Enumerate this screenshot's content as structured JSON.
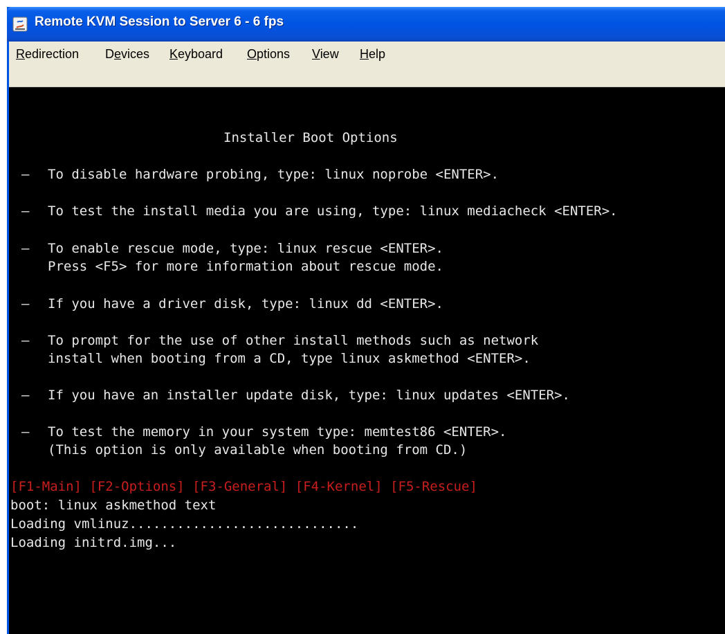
{
  "window": {
    "title": "Remote KVM Session to Server 6 - 6 fps"
  },
  "menu": {
    "items": [
      {
        "pre": "",
        "ul": "R",
        "post": "edirection"
      },
      {
        "pre": "D",
        "ul": "e",
        "post": "vices"
      },
      {
        "pre": "",
        "ul": "K",
        "post": "eyboard"
      },
      {
        "pre": "",
        "ul": "O",
        "post": "ptions"
      },
      {
        "pre": "",
        "ul": "V",
        "post": "iew"
      },
      {
        "pre": "",
        "ul": "H",
        "post": "elp"
      }
    ]
  },
  "console": {
    "heading": "Installer Boot Options",
    "dash": "–",
    "options": [
      {
        "line1": "To disable hardware probing, type: linux noprobe <ENTER>.",
        "line2": ""
      },
      {
        "line1": "To test the install media you are using, type: linux mediacheck <ENTER>.",
        "line2": ""
      },
      {
        "line1": "To enable rescue mode, type: linux rescue <ENTER>.",
        "line2": "Press <F5> for more information about rescue mode."
      },
      {
        "line1": "If you have a driver disk, type: linux dd <ENTER>.",
        "line2": ""
      },
      {
        "line1": "To prompt for the use of other install methods such as network",
        "line2": "install when booting from a CD, type linux askmethod <ENTER>."
      },
      {
        "line1": "If you have an installer update disk, type: linux updates <ENTER>.",
        "line2": ""
      },
      {
        "line1": "To test the memory in your system type: memtest86 <ENTER>.",
        "line2": "(This option is only available when booting from CD.)"
      }
    ],
    "function_keys": "[F1-Main] [F2-Options] [F3-General] [F4-Kernel] [F5-Rescue]",
    "terminal_lines": [
      "boot: linux askmethod text",
      "Loading vmlinuz.............................",
      "Loading initrd.img..."
    ],
    "colors": {
      "text": "#e8e8e8",
      "function_keys": "#c81e1e",
      "background": "#000000"
    }
  }
}
